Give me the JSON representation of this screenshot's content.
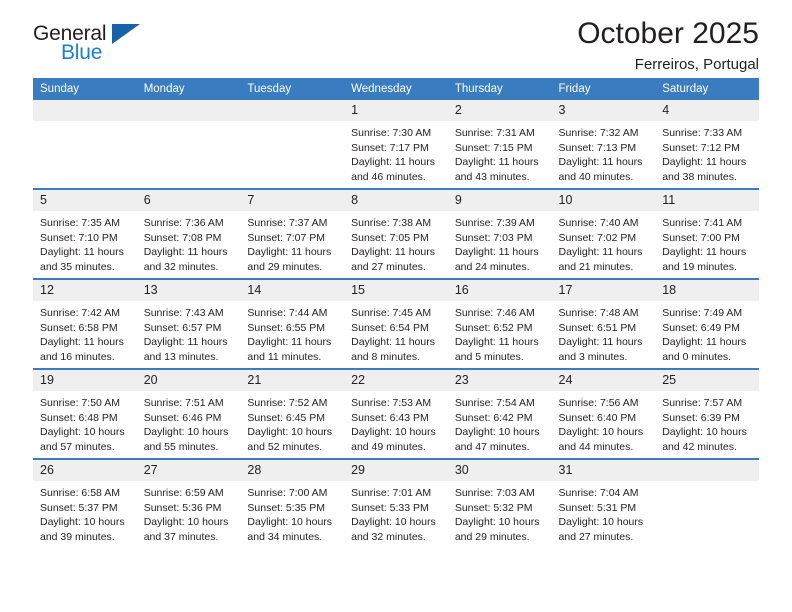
{
  "brand": {
    "name_part1": "General",
    "name_part2": "Blue",
    "triangle_icon": "triangle-icon",
    "accent_color": "#1b7fd4",
    "triangle_color": "#1763a8"
  },
  "header": {
    "title": "October 2025",
    "subtitle": "Ferreiros, Portugal"
  },
  "theme": {
    "header_row_bg": "#3a7cc0",
    "daynum_bg": "#efefef",
    "text_color": "#231f20"
  },
  "weekdays": [
    "Sunday",
    "Monday",
    "Tuesday",
    "Wednesday",
    "Thursday",
    "Friday",
    "Saturday"
  ],
  "weeks": [
    [
      {
        "day": "",
        "empty": true,
        "sunrise": "",
        "sunset": "",
        "daylight_line1": "",
        "daylight_line2": ""
      },
      {
        "day": "",
        "empty": true,
        "sunrise": "",
        "sunset": "",
        "daylight_line1": "",
        "daylight_line2": ""
      },
      {
        "day": "",
        "empty": true,
        "sunrise": "",
        "sunset": "",
        "daylight_line1": "",
        "daylight_line2": ""
      },
      {
        "day": "1",
        "empty": false,
        "sunrise": "Sunrise: 7:30 AM",
        "sunset": "Sunset: 7:17 PM",
        "daylight_line1": "Daylight: 11 hours",
        "daylight_line2": "and 46 minutes."
      },
      {
        "day": "2",
        "empty": false,
        "sunrise": "Sunrise: 7:31 AM",
        "sunset": "Sunset: 7:15 PM",
        "daylight_line1": "Daylight: 11 hours",
        "daylight_line2": "and 43 minutes."
      },
      {
        "day": "3",
        "empty": false,
        "sunrise": "Sunrise: 7:32 AM",
        "sunset": "Sunset: 7:13 PM",
        "daylight_line1": "Daylight: 11 hours",
        "daylight_line2": "and 40 minutes."
      },
      {
        "day": "4",
        "empty": false,
        "sunrise": "Sunrise: 7:33 AM",
        "sunset": "Sunset: 7:12 PM",
        "daylight_line1": "Daylight: 11 hours",
        "daylight_line2": "and 38 minutes."
      }
    ],
    [
      {
        "day": "5",
        "empty": false,
        "sunrise": "Sunrise: 7:35 AM",
        "sunset": "Sunset: 7:10 PM",
        "daylight_line1": "Daylight: 11 hours",
        "daylight_line2": "and 35 minutes."
      },
      {
        "day": "6",
        "empty": false,
        "sunrise": "Sunrise: 7:36 AM",
        "sunset": "Sunset: 7:08 PM",
        "daylight_line1": "Daylight: 11 hours",
        "daylight_line2": "and 32 minutes."
      },
      {
        "day": "7",
        "empty": false,
        "sunrise": "Sunrise: 7:37 AM",
        "sunset": "Sunset: 7:07 PM",
        "daylight_line1": "Daylight: 11 hours",
        "daylight_line2": "and 29 minutes."
      },
      {
        "day": "8",
        "empty": false,
        "sunrise": "Sunrise: 7:38 AM",
        "sunset": "Sunset: 7:05 PM",
        "daylight_line1": "Daylight: 11 hours",
        "daylight_line2": "and 27 minutes."
      },
      {
        "day": "9",
        "empty": false,
        "sunrise": "Sunrise: 7:39 AM",
        "sunset": "Sunset: 7:03 PM",
        "daylight_line1": "Daylight: 11 hours",
        "daylight_line2": "and 24 minutes."
      },
      {
        "day": "10",
        "empty": false,
        "sunrise": "Sunrise: 7:40 AM",
        "sunset": "Sunset: 7:02 PM",
        "daylight_line1": "Daylight: 11 hours",
        "daylight_line2": "and 21 minutes."
      },
      {
        "day": "11",
        "empty": false,
        "sunrise": "Sunrise: 7:41 AM",
        "sunset": "Sunset: 7:00 PM",
        "daylight_line1": "Daylight: 11 hours",
        "daylight_line2": "and 19 minutes."
      }
    ],
    [
      {
        "day": "12",
        "empty": false,
        "sunrise": "Sunrise: 7:42 AM",
        "sunset": "Sunset: 6:58 PM",
        "daylight_line1": "Daylight: 11 hours",
        "daylight_line2": "and 16 minutes."
      },
      {
        "day": "13",
        "empty": false,
        "sunrise": "Sunrise: 7:43 AM",
        "sunset": "Sunset: 6:57 PM",
        "daylight_line1": "Daylight: 11 hours",
        "daylight_line2": "and 13 minutes."
      },
      {
        "day": "14",
        "empty": false,
        "sunrise": "Sunrise: 7:44 AM",
        "sunset": "Sunset: 6:55 PM",
        "daylight_line1": "Daylight: 11 hours",
        "daylight_line2": "and 11 minutes."
      },
      {
        "day": "15",
        "empty": false,
        "sunrise": "Sunrise: 7:45 AM",
        "sunset": "Sunset: 6:54 PM",
        "daylight_line1": "Daylight: 11 hours",
        "daylight_line2": "and 8 minutes."
      },
      {
        "day": "16",
        "empty": false,
        "sunrise": "Sunrise: 7:46 AM",
        "sunset": "Sunset: 6:52 PM",
        "daylight_line1": "Daylight: 11 hours",
        "daylight_line2": "and 5 minutes."
      },
      {
        "day": "17",
        "empty": false,
        "sunrise": "Sunrise: 7:48 AM",
        "sunset": "Sunset: 6:51 PM",
        "daylight_line1": "Daylight: 11 hours",
        "daylight_line2": "and 3 minutes."
      },
      {
        "day": "18",
        "empty": false,
        "sunrise": "Sunrise: 7:49 AM",
        "sunset": "Sunset: 6:49 PM",
        "daylight_line1": "Daylight: 11 hours",
        "daylight_line2": "and 0 minutes."
      }
    ],
    [
      {
        "day": "19",
        "empty": false,
        "sunrise": "Sunrise: 7:50 AM",
        "sunset": "Sunset: 6:48 PM",
        "daylight_line1": "Daylight: 10 hours",
        "daylight_line2": "and 57 minutes."
      },
      {
        "day": "20",
        "empty": false,
        "sunrise": "Sunrise: 7:51 AM",
        "sunset": "Sunset: 6:46 PM",
        "daylight_line1": "Daylight: 10 hours",
        "daylight_line2": "and 55 minutes."
      },
      {
        "day": "21",
        "empty": false,
        "sunrise": "Sunrise: 7:52 AM",
        "sunset": "Sunset: 6:45 PM",
        "daylight_line1": "Daylight: 10 hours",
        "daylight_line2": "and 52 minutes."
      },
      {
        "day": "22",
        "empty": false,
        "sunrise": "Sunrise: 7:53 AM",
        "sunset": "Sunset: 6:43 PM",
        "daylight_line1": "Daylight: 10 hours",
        "daylight_line2": "and 49 minutes."
      },
      {
        "day": "23",
        "empty": false,
        "sunrise": "Sunrise: 7:54 AM",
        "sunset": "Sunset: 6:42 PM",
        "daylight_line1": "Daylight: 10 hours",
        "daylight_line2": "and 47 minutes."
      },
      {
        "day": "24",
        "empty": false,
        "sunrise": "Sunrise: 7:56 AM",
        "sunset": "Sunset: 6:40 PM",
        "daylight_line1": "Daylight: 10 hours",
        "daylight_line2": "and 44 minutes."
      },
      {
        "day": "25",
        "empty": false,
        "sunrise": "Sunrise: 7:57 AM",
        "sunset": "Sunset: 6:39 PM",
        "daylight_line1": "Daylight: 10 hours",
        "daylight_line2": "and 42 minutes."
      }
    ],
    [
      {
        "day": "26",
        "empty": false,
        "sunrise": "Sunrise: 6:58 AM",
        "sunset": "Sunset: 5:37 PM",
        "daylight_line1": "Daylight: 10 hours",
        "daylight_line2": "and 39 minutes."
      },
      {
        "day": "27",
        "empty": false,
        "sunrise": "Sunrise: 6:59 AM",
        "sunset": "Sunset: 5:36 PM",
        "daylight_line1": "Daylight: 10 hours",
        "daylight_line2": "and 37 minutes."
      },
      {
        "day": "28",
        "empty": false,
        "sunrise": "Sunrise: 7:00 AM",
        "sunset": "Sunset: 5:35 PM",
        "daylight_line1": "Daylight: 10 hours",
        "daylight_line2": "and 34 minutes."
      },
      {
        "day": "29",
        "empty": false,
        "sunrise": "Sunrise: 7:01 AM",
        "sunset": "Sunset: 5:33 PM",
        "daylight_line1": "Daylight: 10 hours",
        "daylight_line2": "and 32 minutes."
      },
      {
        "day": "30",
        "empty": false,
        "sunrise": "Sunrise: 7:03 AM",
        "sunset": "Sunset: 5:32 PM",
        "daylight_line1": "Daylight: 10 hours",
        "daylight_line2": "and 29 minutes."
      },
      {
        "day": "31",
        "empty": false,
        "sunrise": "Sunrise: 7:04 AM",
        "sunset": "Sunset: 5:31 PM",
        "daylight_line1": "Daylight: 10 hours",
        "daylight_line2": "and 27 minutes."
      },
      {
        "day": "",
        "empty": true,
        "sunrise": "",
        "sunset": "",
        "daylight_line1": "",
        "daylight_line2": ""
      }
    ]
  ]
}
